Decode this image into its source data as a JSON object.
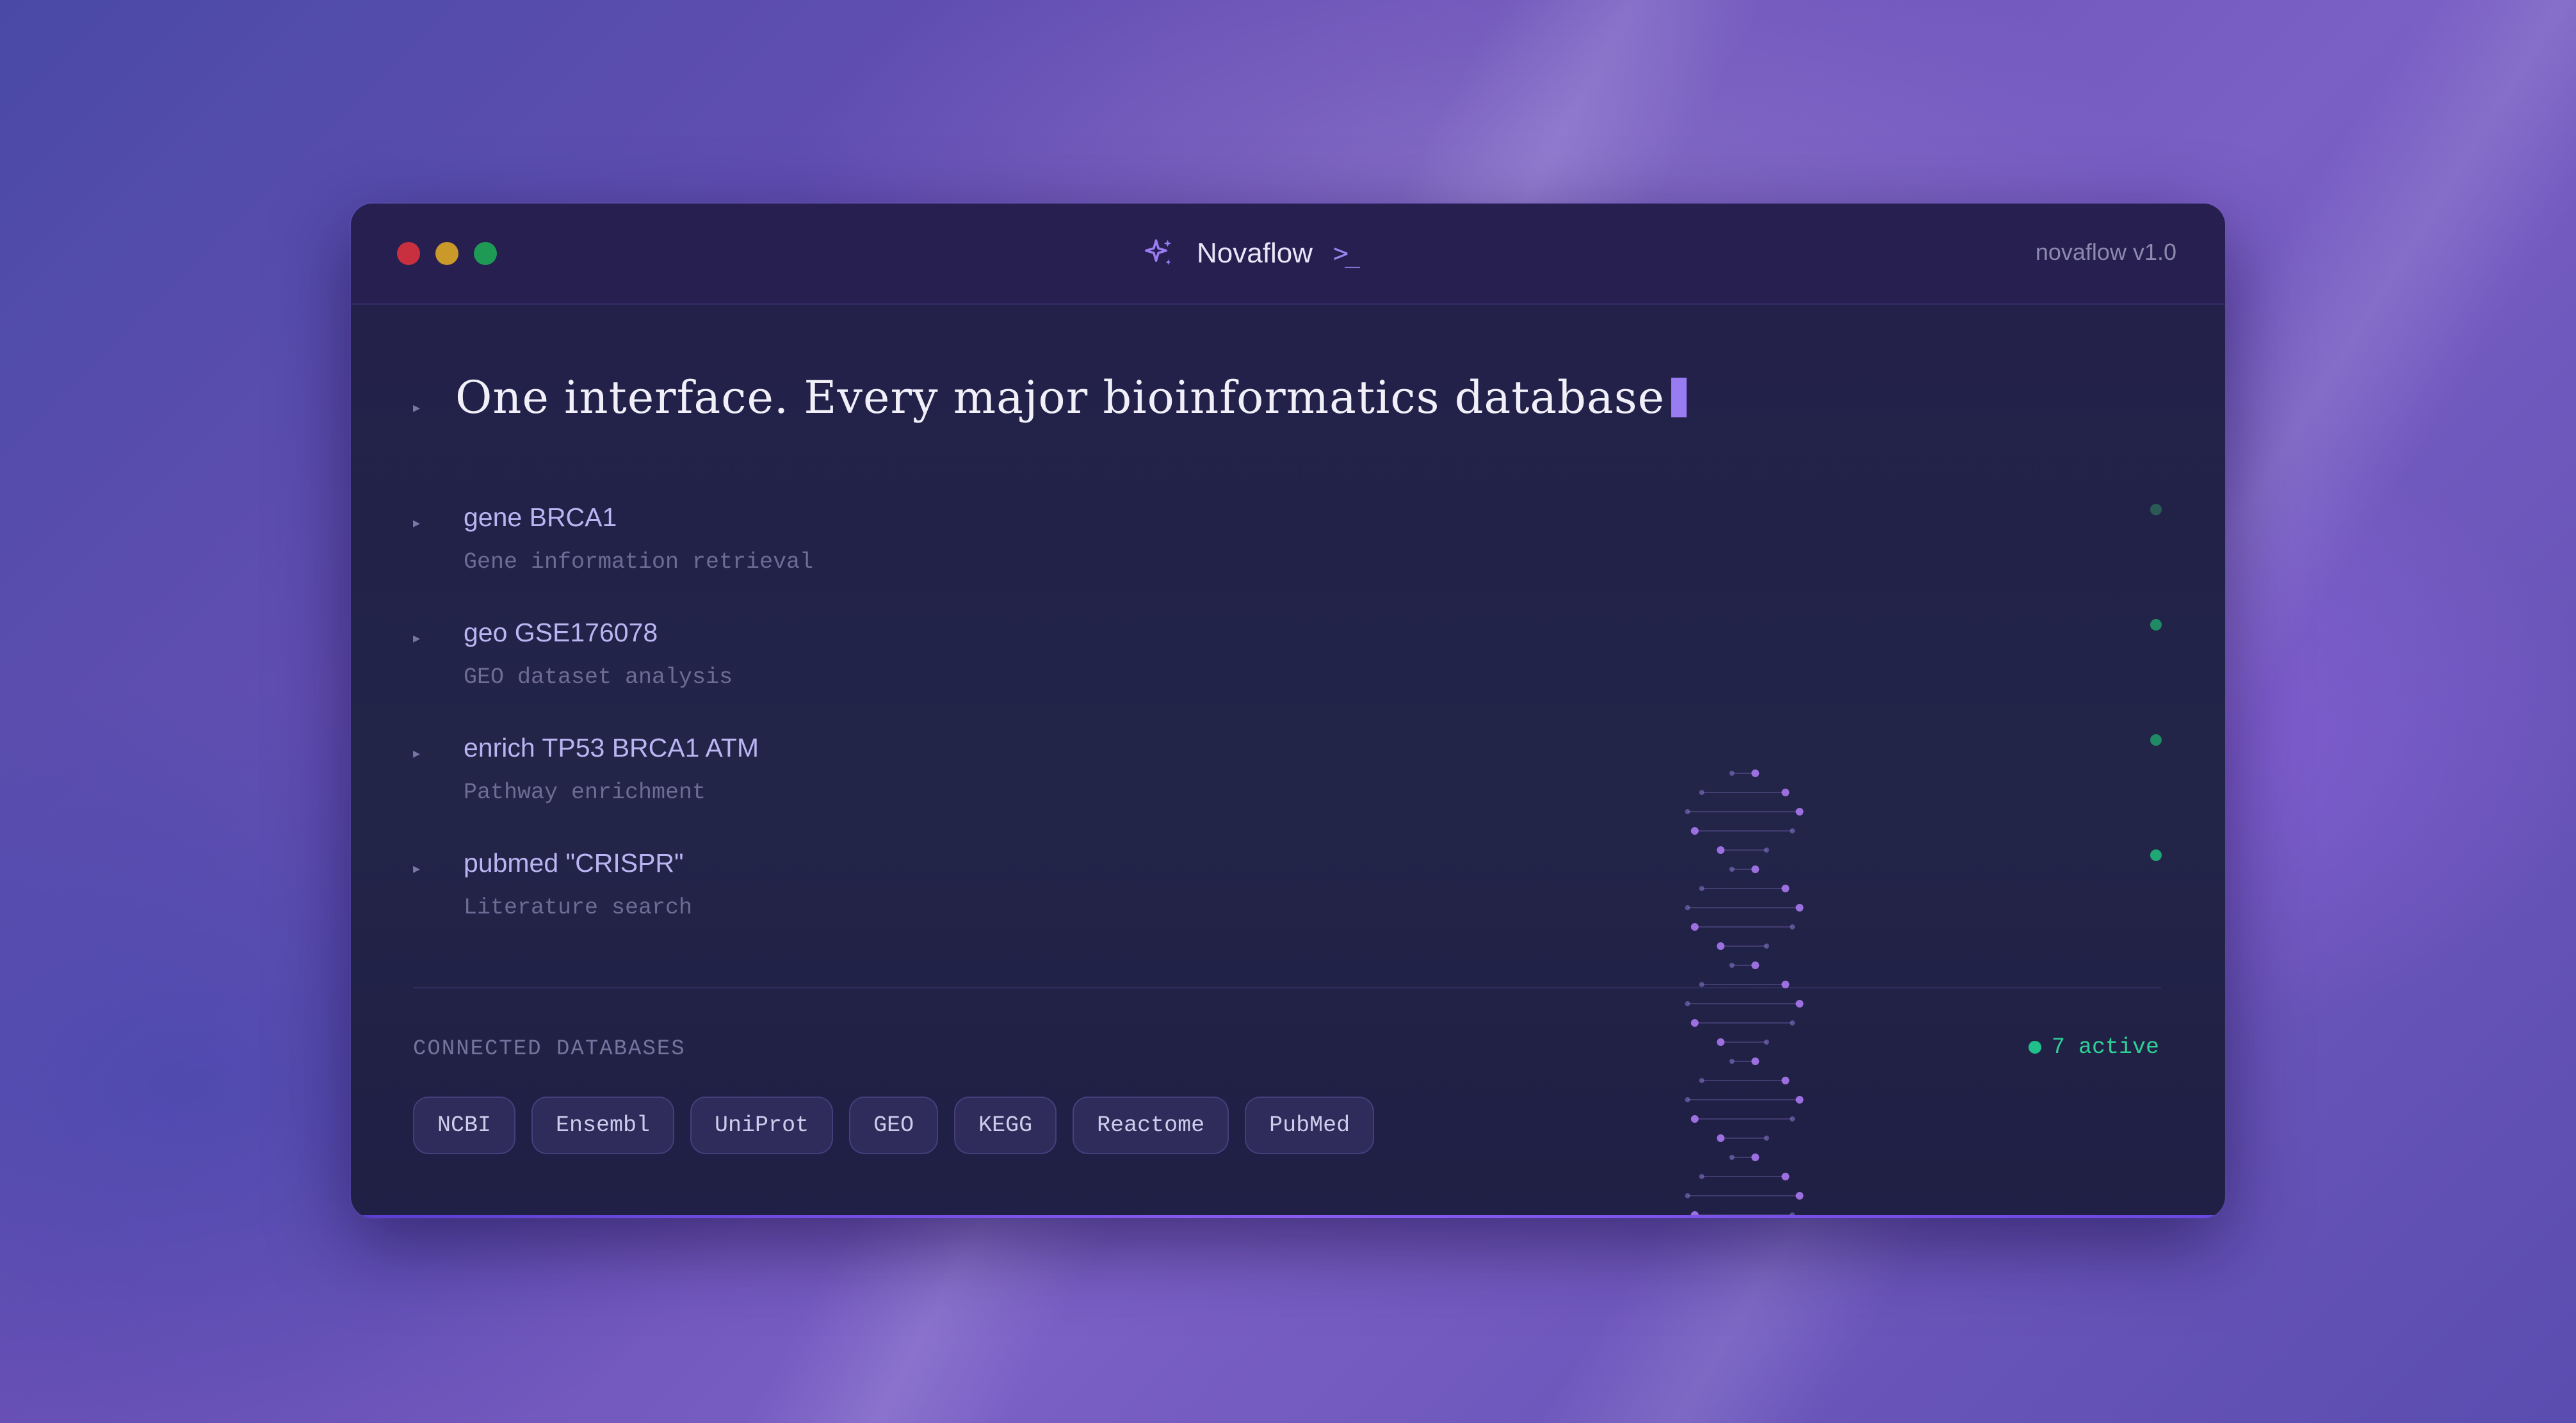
{
  "app": {
    "title": "Novaflow",
    "version": "novaflow v1.0",
    "icon": "sparkle-icon",
    "prompt_icon": ">_"
  },
  "headline": "One interface. Every major bioinformatics database",
  "commands": [
    {
      "command": "gene BRCA1",
      "description": "Gene information retrieval",
      "status": "idle"
    },
    {
      "command": "geo GSE176078",
      "description": "GEO dataset analysis",
      "status": "ready"
    },
    {
      "command": "enrich TP53 BRCA1 ATM",
      "description": "Pathway enrichment",
      "status": "ready"
    },
    {
      "command": "pubmed \"CRISPR\"",
      "description": "Literature search",
      "status": "ready"
    }
  ],
  "connected": {
    "label": "CONNECTED DATABASES",
    "active_text": "7 active",
    "databases": [
      "NCBI",
      "Ensembl",
      "UniProt",
      "GEO",
      "KEGG",
      "Reactome",
      "PubMed"
    ]
  },
  "colors": {
    "accent": "#9a7cf2",
    "status_green": "#1fc08a",
    "status_dim": "#2a5a55"
  }
}
